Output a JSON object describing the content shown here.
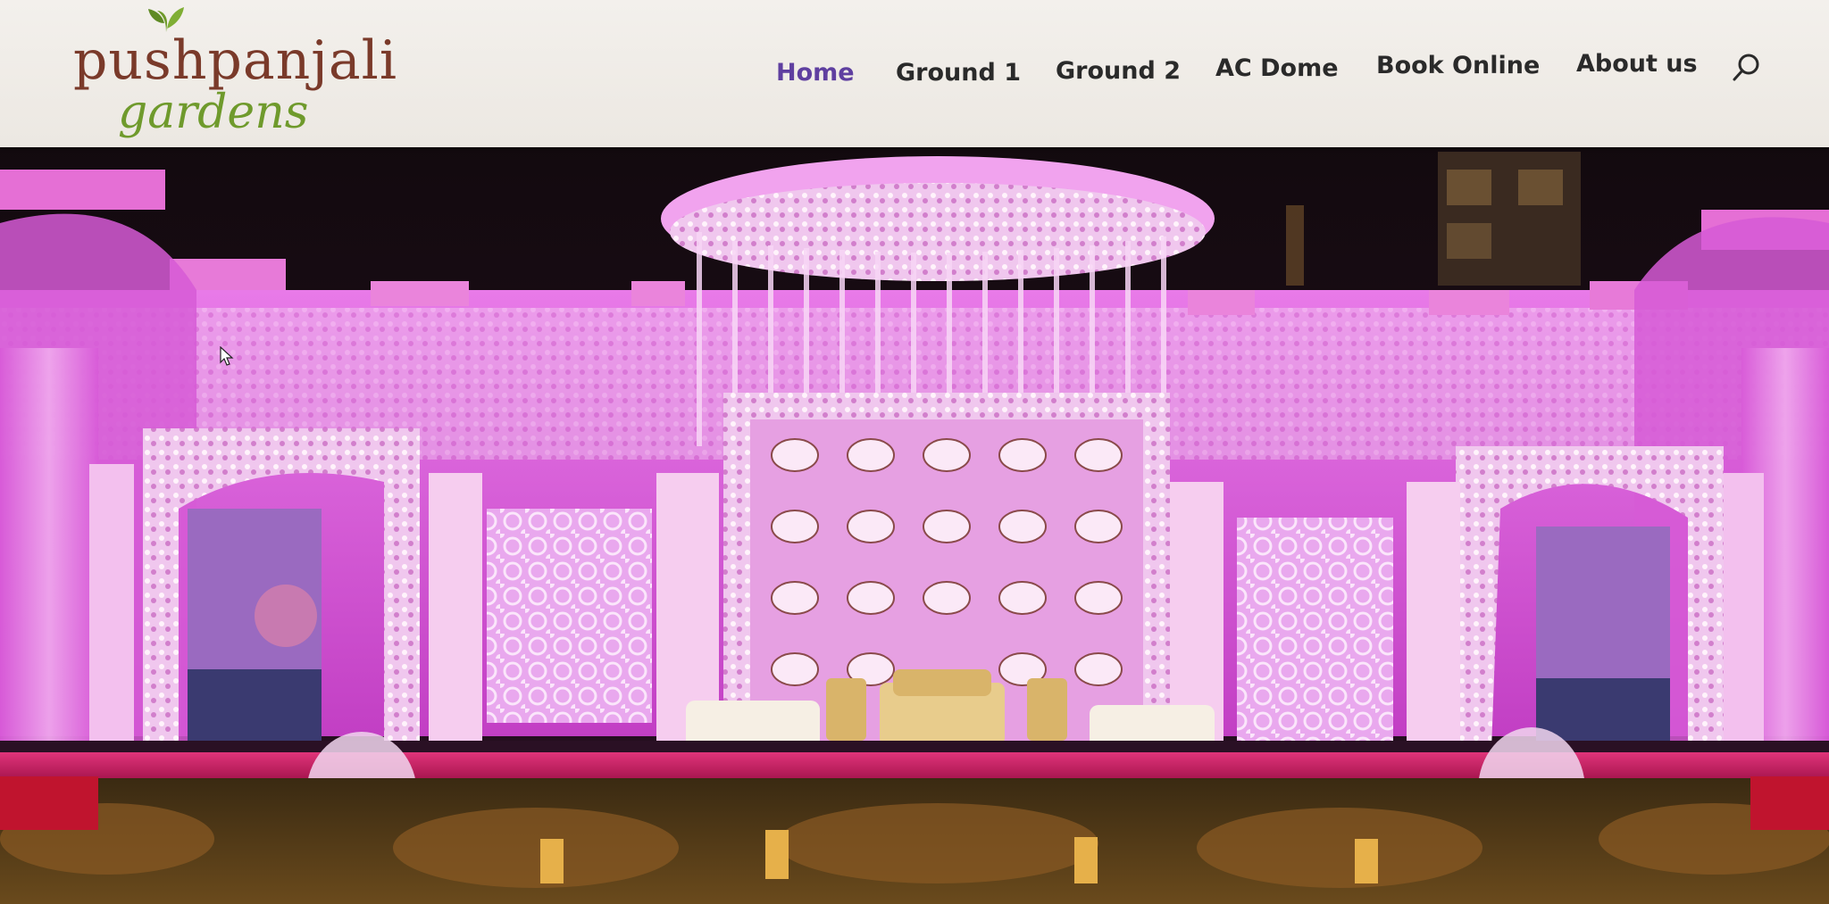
{
  "site": {
    "logo": {
      "line1": "pushpanjali",
      "line2": "gardens",
      "icon": "leaf-icon"
    }
  },
  "nav": {
    "items": [
      {
        "label": "Home",
        "active": true
      },
      {
        "label": "Ground 1",
        "active": false
      },
      {
        "label": "Ground 2",
        "active": false
      },
      {
        "label": "AC Dome",
        "active": false
      },
      {
        "label": "Book Online",
        "active": false
      },
      {
        "label": "About us",
        "active": false
      }
    ],
    "search_icon": "search-icon"
  },
  "hero": {
    "image_icon": "wedding-stage-image",
    "colors": {
      "stage": "#d44ad6",
      "night": "#1a0f14",
      "carpet": "#c21f5e"
    }
  },
  "colors": {
    "accent": "#5f3fa0",
    "nav_text": "#2a2a2a",
    "logo_brown": "#7a3a2a",
    "logo_green": "#6f9a2c"
  }
}
